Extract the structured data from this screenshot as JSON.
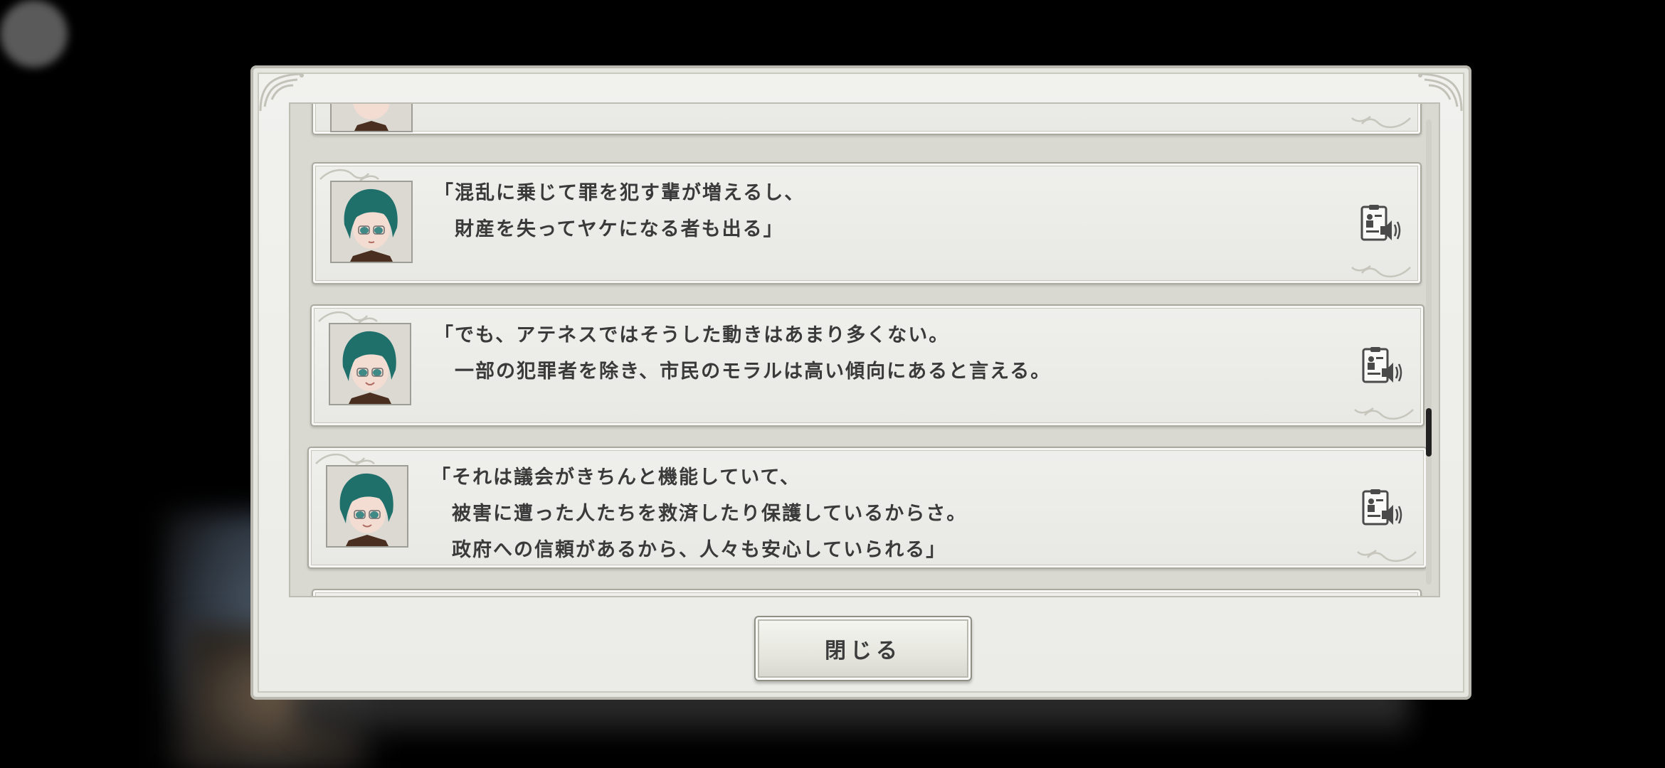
{
  "log": {
    "entries": [
      {
        "speaker_icon": "character-portrait",
        "lines": [
          "",
          ""
        ]
      },
      {
        "speaker_icon": "character-portrait",
        "lines": [
          "「混乱に乗じて罪を犯す輩が増えるし、",
          "　財産を失ってヤケになる者も出る」"
        ]
      },
      {
        "speaker_icon": "character-portrait",
        "lines": [
          "「でも、アテネスではそうした動きはあまり多くない。",
          "　一部の犯罪者を除き、市民のモラルは高い傾向にあると言える。"
        ]
      },
      {
        "speaker_icon": "character-portrait",
        "lines": [
          "「それは議会がきちんと機能していて、",
          "　被害に遭った人たちを救済したり保護しているからさ。",
          "　政府への信頼があるから、人々も安心していられる」"
        ]
      }
    ],
    "voice_icon": "voice-replay-icon"
  },
  "buttons": {
    "close_label": "閉じる"
  },
  "scroll": {
    "position_fraction": 0.62
  },
  "colors": {
    "panel": "#ebebe7",
    "text": "#3a3a3a",
    "hair": "#1f6f6a",
    "scroll_thumb": "#222222"
  }
}
